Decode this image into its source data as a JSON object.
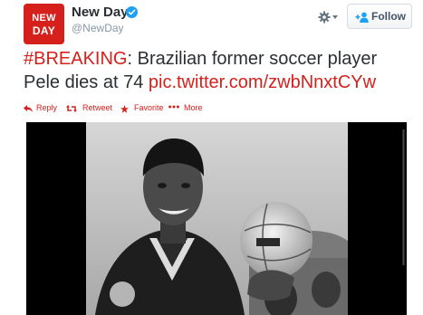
{
  "account": {
    "avatar_line1": "NEW",
    "avatar_line2": "DAY",
    "name": "New Day",
    "handle": "@NewDay"
  },
  "controls": {
    "follow_label": "Follow"
  },
  "tweet": {
    "hashtag": "#BREAKING",
    "body": ": Brazilian former soccer player Pele dies at 74 ",
    "link": "pic.twitter.com/zwbNnxtCYw"
  },
  "actions": {
    "reply": "Reply",
    "retweet": "Retweet",
    "favorite": "Favorite",
    "more": "More"
  },
  "colors": {
    "brand": "#d6201c",
    "text": "#292f33",
    "muted": "#8899a6",
    "verified": "#1da1f2"
  }
}
